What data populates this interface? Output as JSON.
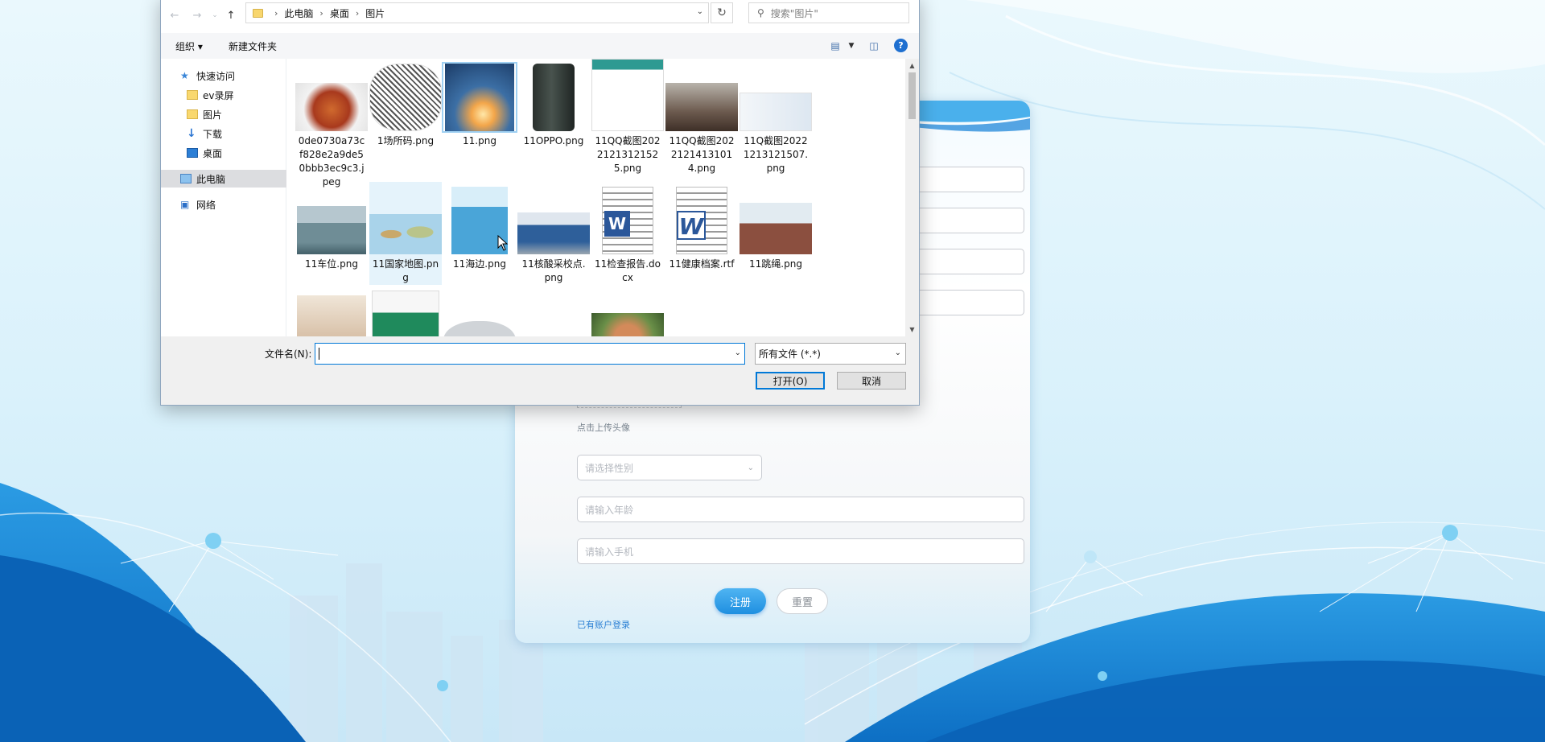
{
  "dialog": {
    "breadcrumb": [
      "此电脑",
      "桌面",
      "图片"
    ],
    "search_placeholder": "搜索\"图片\"",
    "toolbar": {
      "organize": "组织 ▾",
      "new_folder": "新建文件夹",
      "help": "?"
    },
    "nav": [
      {
        "label": "快速访问",
        "icon": "star-icon"
      },
      {
        "label": "ev录屏",
        "icon": "folder-icon"
      },
      {
        "label": "图片",
        "icon": "folder-icon"
      },
      {
        "label": "下载",
        "icon": "download-icon"
      },
      {
        "label": "桌面",
        "icon": "desktop-icon"
      },
      {
        "label": "此电脑",
        "icon": "computer-icon"
      },
      {
        "label": "网络",
        "icon": "network-icon"
      }
    ],
    "files": [
      {
        "name": "0de0730a73cf828e2a9de50bbb3ec9c3.jpeg",
        "color": "#c4562a"
      },
      {
        "name": "1场所码.png",
        "color": "#555555"
      },
      {
        "name": "11.png",
        "color": "#3a7ab5"
      },
      {
        "name": "11OPPO.png",
        "color": "#2f3a36"
      },
      {
        "name": "11QQ截图20221213121525.png",
        "color": "#3fa69b"
      },
      {
        "name": "11QQ截图20221214131014.png",
        "color": "#7e6a5d"
      },
      {
        "name": "11Q截图20221213121507.png",
        "color": "#d8e4ee"
      },
      {
        "name": "11车位.png",
        "color": "#6f8d96"
      },
      {
        "name": "11国家地图.png",
        "color": "#9cc9e0"
      },
      {
        "name": "11海边.png",
        "color": "#3b93c9"
      },
      {
        "name": "11核酸采校点.png",
        "color": "#2e5f9a"
      },
      {
        "name": "11检查报告.docx",
        "color": "#2b579a"
      },
      {
        "name": "11健康档案.rtf",
        "color": "#2b579a"
      },
      {
        "name": "11跳绳.png",
        "color": "#8b4f3f"
      },
      {
        "name": "",
        "color": "#e8d8c4"
      },
      {
        "name": "",
        "color": "#1f8a5c"
      },
      {
        "name": "",
        "color": "#d0d4d8"
      },
      {
        "name": "",
        "color": "#b86e4a"
      }
    ],
    "filename_label": "文件名(N):",
    "filename_value": "",
    "filetype": "所有文件 (*.*)",
    "open_label": "打开(O)",
    "cancel_label": "取消"
  },
  "register": {
    "avatar_hint": "点击上传头像",
    "gender_placeholder": "请选择性别",
    "age_placeholder": "请输入年龄",
    "phone_placeholder": "请输入手机",
    "register_label": "注册",
    "reset_label": "重置",
    "login_link": "已有账户登录"
  },
  "colors": {
    "accent": "#0078d7",
    "register_button": "#2a98e6",
    "background": "#dff3fb"
  }
}
